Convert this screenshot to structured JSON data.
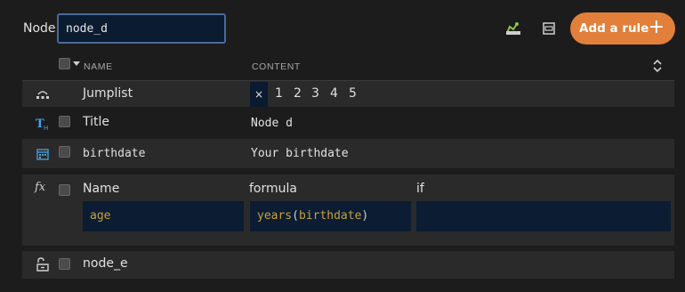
{
  "header": {
    "node_label": "Node",
    "node_value": "node_d",
    "add_rule_label": "Add a rule",
    "add_rule_symbol": "+"
  },
  "columns": {
    "name": "NAME",
    "content": "CONTENT"
  },
  "rows": {
    "jumplist": {
      "title": "Jumplist",
      "clear": "×",
      "pages": [
        "1",
        "2",
        "3",
        "4",
        "5"
      ]
    },
    "title": {
      "title": "Title",
      "content": "Node d"
    },
    "birthdate": {
      "title": "birthdate",
      "content": "Your birthdate"
    },
    "formula": {
      "fx": "fx",
      "headers": {
        "name": "Name",
        "formula": "formula",
        "if": "if"
      },
      "name_value": "age",
      "formula_func": "years",
      "formula_open": "(",
      "formula_arg": "birthdate",
      "formula_close": ")",
      "if_value": ""
    },
    "link": {
      "title": "node_e"
    }
  },
  "colors": {
    "accent": "#e27f3a",
    "formula_text": "#c9a13a",
    "input_bg": "#0b1c33"
  }
}
